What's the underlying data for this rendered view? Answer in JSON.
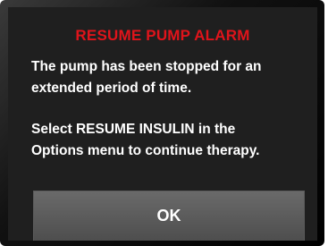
{
  "alarm": {
    "title": "RESUME PUMP ALARM",
    "message_lines_1": [
      "The pump has been stopped for an",
      "extended period of time."
    ],
    "message_lines_2": [
      "Select RESUME INSULIN in the",
      "Options menu to continue therapy."
    ],
    "button_label": "OK"
  },
  "colors": {
    "title": "#e0141b",
    "screen_background": "#1f1f1f",
    "text": "#ffffff",
    "button_background": "#5a5a5a"
  }
}
